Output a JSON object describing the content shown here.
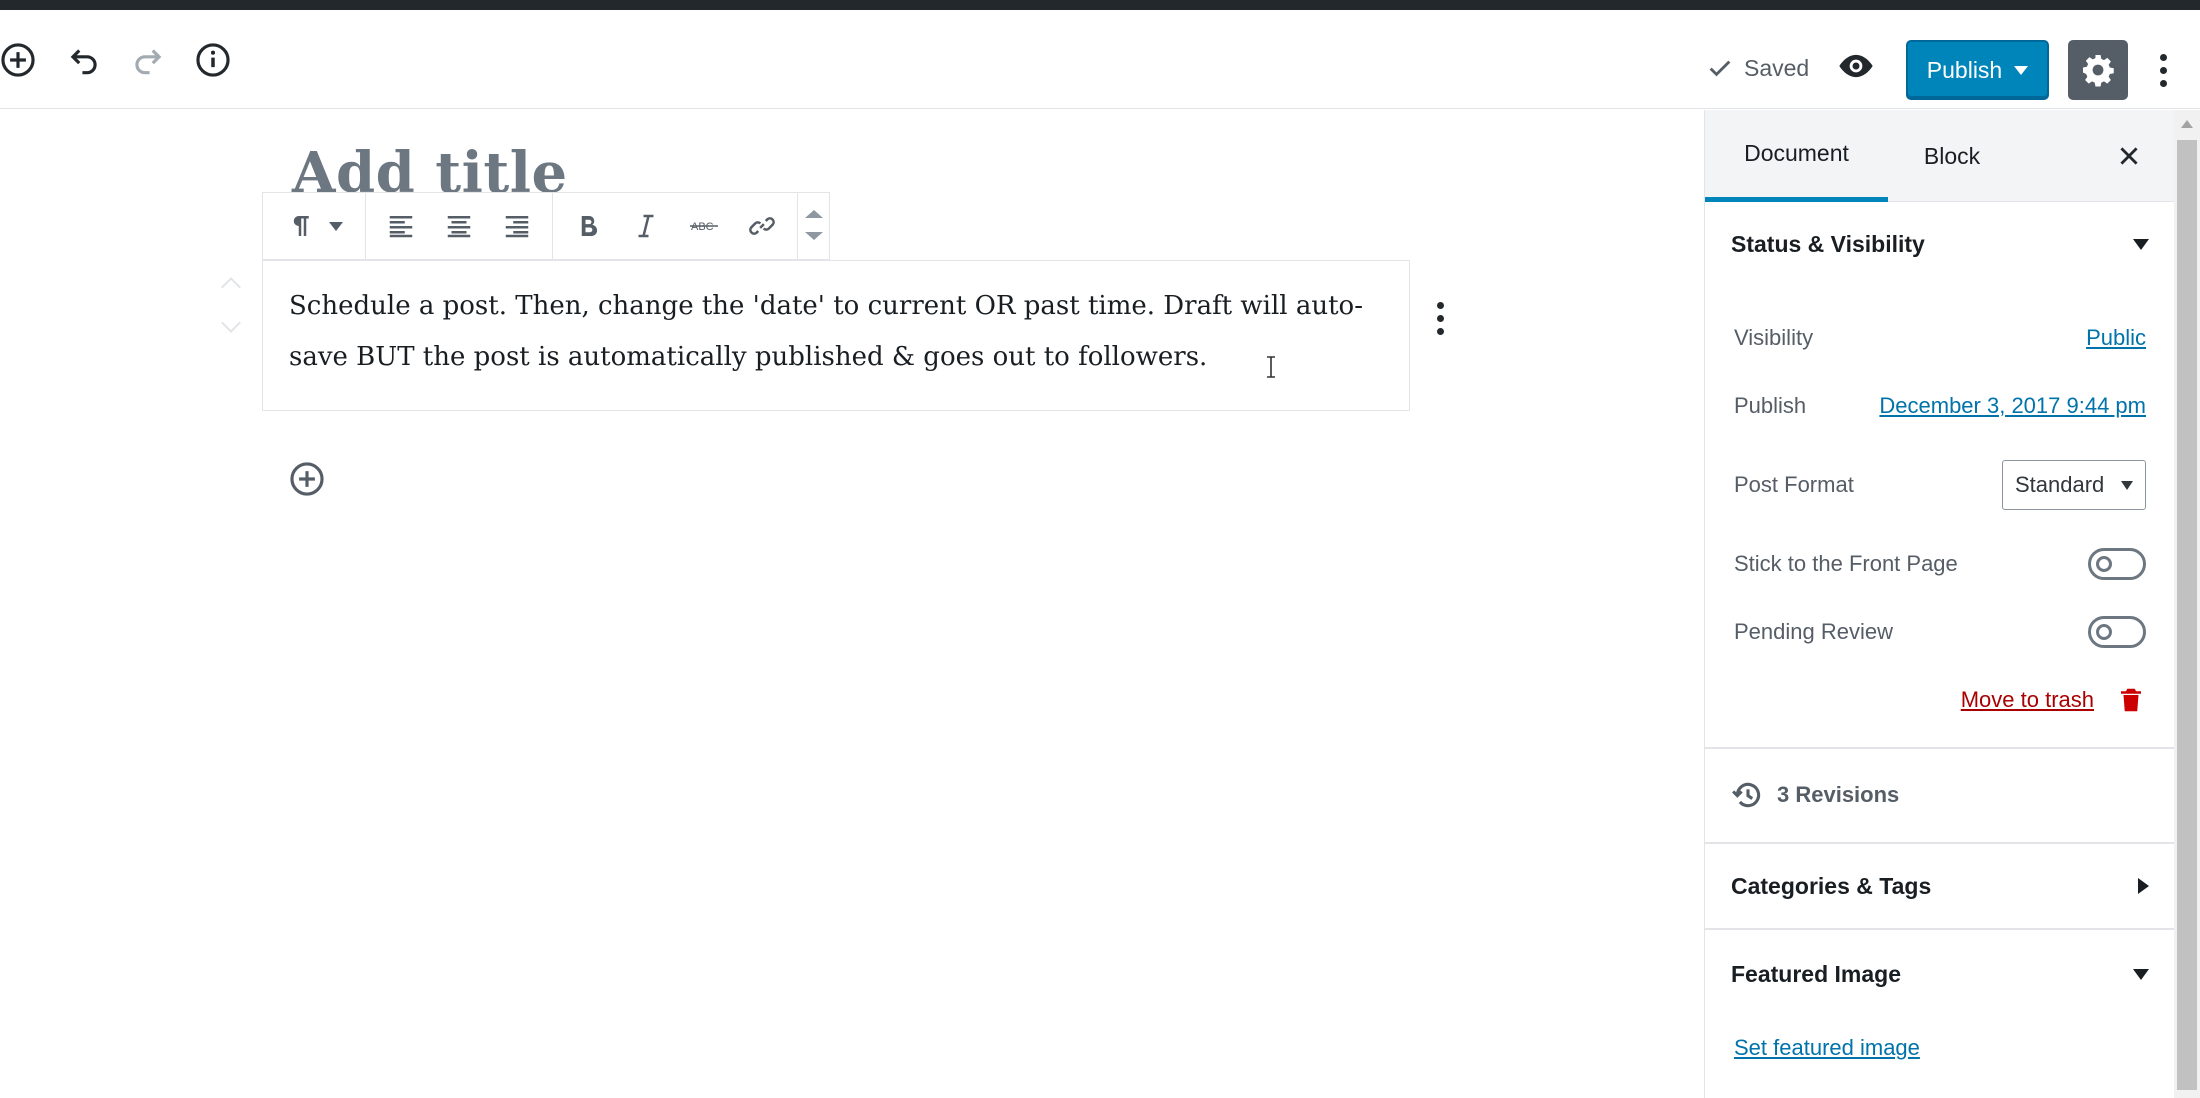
{
  "header": {
    "saved_label": "Saved",
    "publish_label": "Publish"
  },
  "editor": {
    "title_placeholder": "Add title",
    "paragraph_text": "Schedule a post. Then, change the 'date' to current OR past time. Draft will auto-save BUT the post is automatically published & goes out to followers."
  },
  "sidebar": {
    "tabs": [
      "Document",
      "Block"
    ],
    "active_tab": "Document",
    "status_panel": {
      "title": "Status & Visibility",
      "visibility_label": "Visibility",
      "visibility_value": "Public",
      "publish_label": "Publish",
      "publish_value": "December 3, 2017 9:44 pm",
      "post_format_label": "Post Format",
      "post_format_value": "Standard",
      "stick_label": "Stick to the Front Page",
      "stick_on": false,
      "pending_label": "Pending Review",
      "pending_on": false,
      "trash_label": "Move to trash"
    },
    "revisions_label": "3 Revisions",
    "categories_title": "Categories & Tags",
    "featured_title": "Featured Image",
    "featured_link": "Set featured image"
  },
  "colors": {
    "accent": "#0085ba",
    "danger": "#a00",
    "link": "#0073aa"
  }
}
